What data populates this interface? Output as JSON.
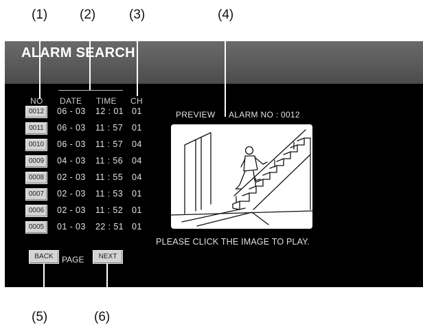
{
  "callouts": [
    "(1)",
    "(2)",
    "(3)",
    "(4)",
    "(5)",
    "(6)"
  ],
  "screen": {
    "title": "ALARM SEARCH",
    "columns": {
      "no": "NO",
      "date": "DATE",
      "time": "TIME",
      "ch": "CH"
    },
    "rows": [
      {
        "no": "0012",
        "date": "06 - 03",
        "time": "12 : 01",
        "ch": "01"
      },
      {
        "no": "0011",
        "date": "06 - 03",
        "time": "11 : 57",
        "ch": "01"
      },
      {
        "no": "0010",
        "date": "06 - 03",
        "time": "11 : 57",
        "ch": "04"
      },
      {
        "no": "0009",
        "date": "04 - 03",
        "time": "11 : 56",
        "ch": "04"
      },
      {
        "no": "0008",
        "date": "02 - 03",
        "time": "11 : 55",
        "ch": "04"
      },
      {
        "no": "0007",
        "date": "02 - 03",
        "time": "11 : 53",
        "ch": "01"
      },
      {
        "no": "0006",
        "date": "02 - 03",
        "time": "11 : 52",
        "ch": "01"
      },
      {
        "no": "0005",
        "date": "01 - 03",
        "time": "22 : 51",
        "ch": "01"
      }
    ],
    "preview": {
      "label": "PREVIEW",
      "alarm_no": "ALARM NO : 0012"
    },
    "hint": "PLEASE CLICK THE IMAGE TO PLAY.",
    "pager": {
      "back": "BACK",
      "page": "PAGE",
      "next": "NEXT"
    }
  },
  "colors": {
    "screen_bg": "#000000",
    "titlebar": "#5a5a5a",
    "button": "#d4d4d4",
    "text": "#e2e2e2"
  },
  "icons": {
    "preview_image": "person-climbing-stairs-illustration"
  }
}
